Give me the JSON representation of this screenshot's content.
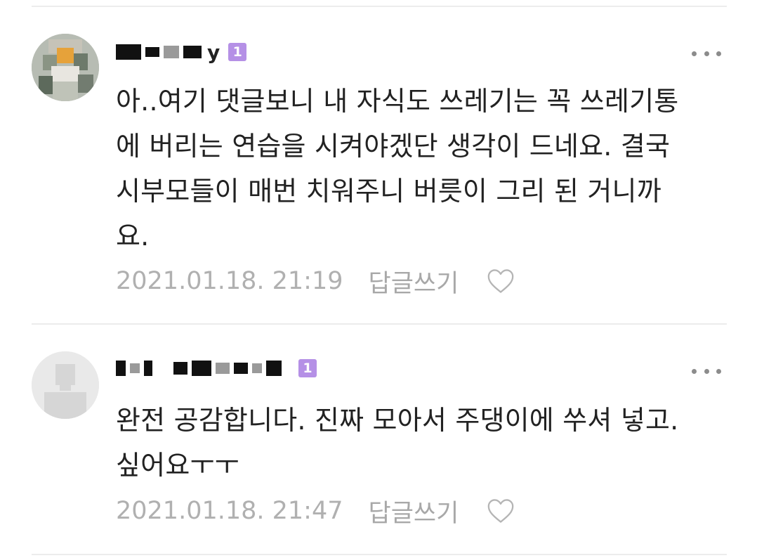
{
  "comments": [
    {
      "username_visible_tail": "y",
      "level_badge": "1",
      "text": "아..여기 댓글보니 내 자식도 쓰레기는 꼭 쓰레기통\n에 버리는 연습을 시켜야겠단 생각이 드네요. 결국\n시부모들이 매번 치워주니 버릇이 그리 된 거니까\n요.",
      "timestamp": "2021.01.18. 21:19",
      "reply_label": "답글쓰기"
    },
    {
      "username_visible_tail": "",
      "level_badge": "1",
      "text": "완전 공감합니다. 진짜 모아서 주댕이에 쑤셔 넣고.\n싶어요ㅜㅜ",
      "timestamp": "2021.01.18. 21:47",
      "reply_label": "답글쓰기"
    }
  ],
  "icons": {
    "more": "more-horizontal-icon",
    "like": "heart-outline-icon",
    "avatar_default": "default-user-icon"
  },
  "colors": {
    "badge": "#b590e6",
    "text": "#222222",
    "meta": "#b0b0b0",
    "divider": "#ececec"
  }
}
